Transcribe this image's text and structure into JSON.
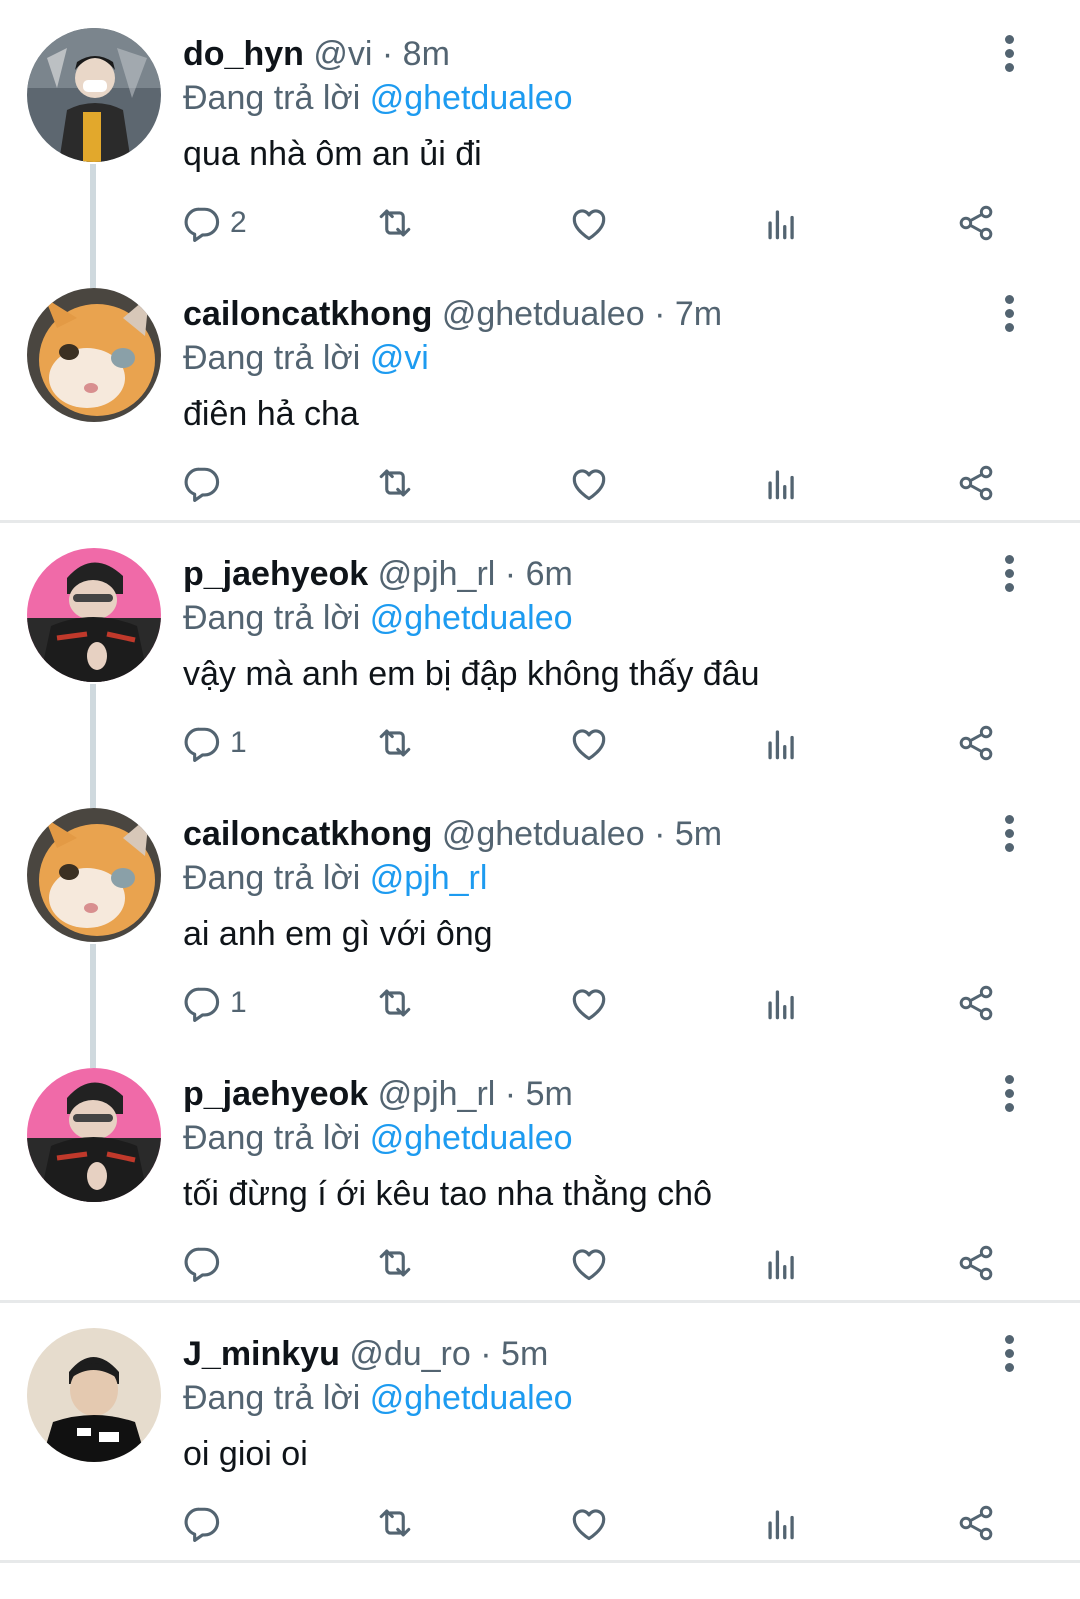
{
  "colors": {
    "accent": "#1d9bf0",
    "secondary_text": "#536471",
    "primary_text": "#0f1419",
    "divider": "#e7e9ea"
  },
  "tweets": [
    {
      "display_name": "do_hyn",
      "handle": "@vi",
      "separator": "·",
      "time": "8m",
      "reply_prefix": "Đang trả lời",
      "reply_to": "@ghetdualeo",
      "text": "qua nhà ôm an ủi đi",
      "reply_count": "2"
    },
    {
      "display_name": "cailoncatkhong",
      "handle": "@ghetdualeo",
      "separator": "·",
      "time": "7m",
      "reply_prefix": "Đang trả lời",
      "reply_to": "@vi",
      "text": "điên hả cha",
      "reply_count": ""
    },
    {
      "display_name": "p_jaehyeok",
      "handle": "@pjh_rl",
      "separator": "·",
      "time": "6m",
      "reply_prefix": "Đang trả lời",
      "reply_to": "@ghetdualeo",
      "text": "vậy mà anh em bị đập không thấy đâu",
      "reply_count": "1"
    },
    {
      "display_name": "cailoncatkhong",
      "handle": "@ghetdualeo",
      "separator": "·",
      "time": "5m",
      "reply_prefix": "Đang trả lời",
      "reply_to": "@pjh_rl",
      "text": "ai anh em gì với ông",
      "reply_count": "1"
    },
    {
      "display_name": "p_jaehyeok",
      "handle": "@pjh_rl",
      "separator": "·",
      "time": "5m",
      "reply_prefix": "Đang trả lời",
      "reply_to": "@ghetdualeo",
      "text": "tối đừng í ới kêu tao nha thằng chô",
      "reply_count": ""
    },
    {
      "display_name": "J_minkyu",
      "handle": "@du_ro",
      "separator": "·",
      "time": "5m",
      "reply_prefix": "Đang trả lời",
      "reply_to": "@ghetdualeo",
      "text": "oi gioi oi",
      "reply_count": ""
    }
  ]
}
